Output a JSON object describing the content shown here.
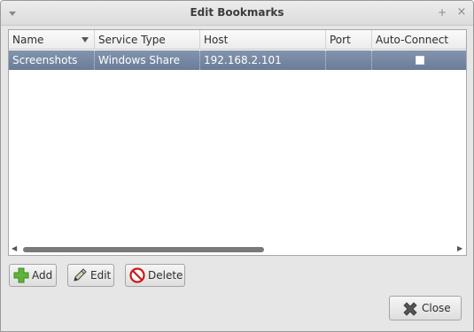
{
  "window": {
    "title": "Edit Bookmarks",
    "maximize_glyph": "+",
    "close_glyph": "×"
  },
  "list": {
    "columns": [
      "Name",
      "Service Type",
      "Host",
      "Port",
      "Auto-Connect"
    ],
    "sort_column": "Name",
    "rows": [
      {
        "name": "Screenshots",
        "service_type": "Windows Share",
        "host": "192.168.2.101",
        "port": "",
        "auto_connect": false,
        "selected": true
      }
    ],
    "scroll_left_glyph": "◀",
    "scroll_right_glyph": "▶"
  },
  "buttons": {
    "add": "Add",
    "edit": "Edit",
    "delete": "Delete",
    "close": "Close"
  },
  "icons": {
    "add": "green-plus-icon",
    "edit": "pencil-icon",
    "delete": "no-entry-icon",
    "close": "x-close-icon"
  },
  "colors": {
    "selection": "#7386a2",
    "add_icon": "#5fb33a",
    "delete_icon": "#d01818"
  }
}
